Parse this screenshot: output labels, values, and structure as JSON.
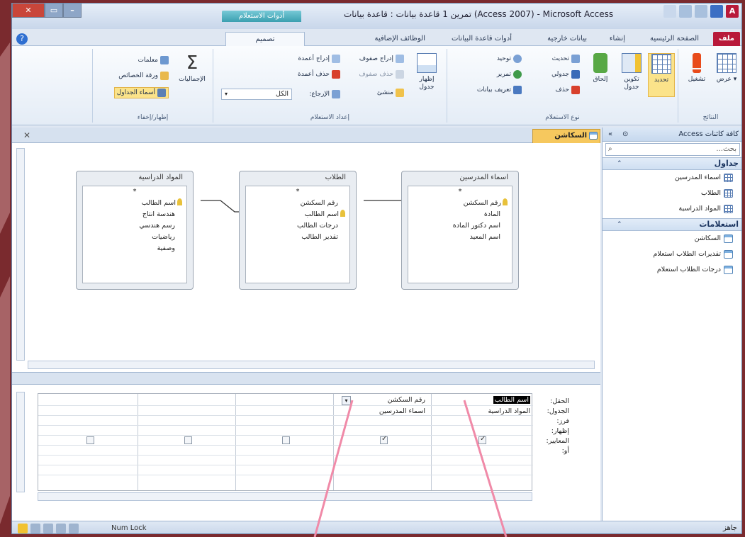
{
  "window": {
    "title": "تمرين 1 قاعدة بيانات : قاعدة بيانات (Access 2007) - Microsoft Access",
    "context_tab": "أدوات الاستعلام"
  },
  "tabs": [
    {
      "label": "ملف"
    },
    {
      "label": "الصفحة الرئيسية"
    },
    {
      "label": "إنشاء"
    },
    {
      "label": "بيانات خارجية"
    },
    {
      "label": "أدوات قاعدة البيانات"
    },
    {
      "label": "الوظائف الإضافية"
    },
    {
      "label": "تصميم"
    }
  ],
  "ribbon": {
    "results": {
      "label": "النتائج",
      "view": "عرض",
      "run": "تشغيل"
    },
    "query_type": {
      "label": "نوع الاستعلام",
      "select": "تحديد",
      "make_table": "تكوين جدول",
      "append": "إلحاق",
      "update": "تحديث",
      "crosstab": "جدولي",
      "delete": "حذف",
      "union": "توحيد",
      "pass_through": "تمرير",
      "data_definition": "تعريف بيانات"
    },
    "setup": {
      "label": "إعداد الاستعلام",
      "show_table": "إظهار جدول",
      "insert_rows": "إدراج صفوف",
      "delete_rows": "حذف صفوف",
      "builder": "منشئ",
      "insert_columns": "إدراج أعمدة",
      "delete_columns": "حذف أعمدة",
      "return_label": "الإرجاع:",
      "return_value": "الكل"
    },
    "show_hide": {
      "label": "إظهار/إخفاء",
      "totals": "الإجماليات",
      "parameters": "معلمات",
      "property_sheet": "ورقة الخصائص",
      "table_names": "أسماء الجداول"
    }
  },
  "nav": {
    "header": "كافة كائنات Access",
    "search_placeholder": "بحث...",
    "sections": [
      {
        "title": "جداول",
        "items": [
          "اسماء المدرسين",
          "الطلاب",
          "المواد الدراسية"
        ]
      },
      {
        "title": "استعلامات",
        "items": [
          "السكاشن",
          "تقديرات الطلاب استعلام",
          "درجات الطلاب استعلام"
        ]
      }
    ]
  },
  "document": {
    "tab_label": "السكاشن",
    "tables": [
      {
        "title": "اسماء المدرسين",
        "fields": [
          "*",
          "رقم السكشن",
          "المادة",
          "اسم دكتور المادة",
          "اسم المعيد"
        ],
        "key_index": 1
      },
      {
        "title": "الطلاب",
        "fields": [
          "*",
          "رقم السكشن",
          "اسم الطالب",
          "درجات الطالب",
          "تقدير الطالب"
        ],
        "key_index": 2
      },
      {
        "title": "المواد الدراسية",
        "fields": [
          "*",
          "اسم الطالب",
          "هندسة انتاج",
          "رسم هندسي",
          "رياضيات",
          "وصفية"
        ],
        "key_index": 1
      }
    ],
    "grid": {
      "row_labels": [
        "الحقل:",
        "الجدول:",
        "فرز:",
        "إظهار:",
        "المعايير:",
        "أو:"
      ],
      "columns": [
        {
          "field": "اسم الطالب",
          "table": "المواد الدراسية",
          "show": true
        },
        {
          "field": "رقم السكشن",
          "table": "اسماء المدرسين",
          "show": true
        },
        {
          "field": "",
          "table": "",
          "show": false
        },
        {
          "field": "",
          "table": "",
          "show": false
        },
        {
          "field": "",
          "table": "",
          "show": false
        }
      ]
    }
  },
  "status": {
    "left": "جاهز",
    "numlock": "Num Lock"
  }
}
